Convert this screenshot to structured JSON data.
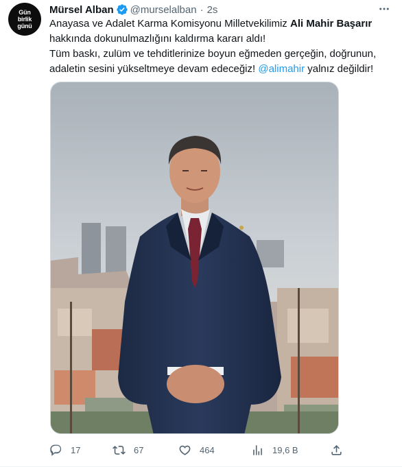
{
  "tweet": {
    "avatar_lines": [
      "Gün",
      "birlik",
      "günü"
    ],
    "author_name": "Mürsel Alban",
    "handle": "@murselalban",
    "separator": "·",
    "time": "2s",
    "text": {
      "line1_prefix": "Anayasa ve Adalet Karma Komisyonu Milletvekilimiz ",
      "line1_bold": "Ali Mahir Başarır",
      "line2": "hakkında dokunulmazlığını kaldırma kararı aldı!",
      "line3": "Tüm baskı, zulüm ve tehditlerinize boyun eğmeden gerçeğin, doğrunun,",
      "line4_prefix": "adaletin sesini yükseltmeye devam edeceğiz! ",
      "mention": "@alimahir",
      "line4_suffix": " yalnız değildir!"
    }
  },
  "actions": {
    "reply_count": "17",
    "retweet_count": "67",
    "like_count": "464",
    "views_count": "19,6 B"
  },
  "icons": {
    "verified": "verified-badge-icon",
    "more": "more-options-icon",
    "reply": "reply-icon",
    "retweet": "retweet-icon",
    "like": "heart-icon",
    "views": "views-chart-icon",
    "share": "share-icon"
  },
  "colors": {
    "accent": "#1d9bf0",
    "text_primary": "#0f1419",
    "text_secondary": "#536471",
    "border": "#cfd9de"
  }
}
